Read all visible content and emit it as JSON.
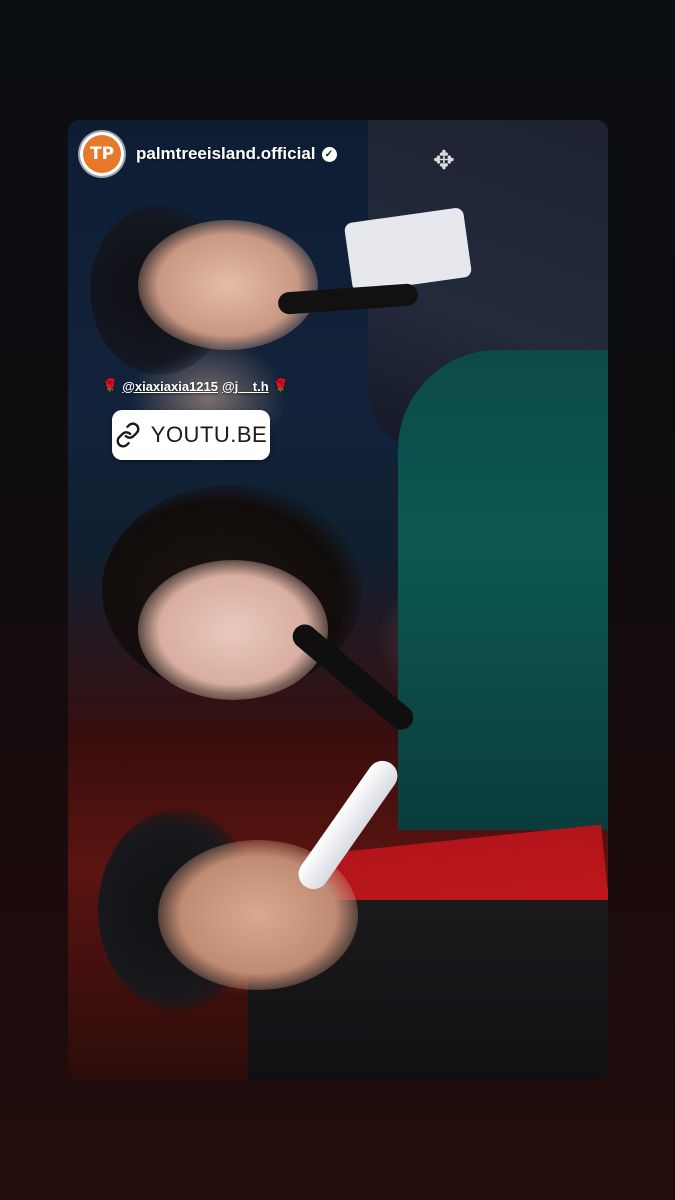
{
  "story": {
    "account": {
      "username": "palmtreeisland.official",
      "avatar_text": "TP",
      "avatar_color": "#e8792b",
      "verified_icon": "verified-badge-icon"
    },
    "mentions": {
      "leading_emoji": "🌹",
      "users": [
        "@xiaxiaxia1215",
        "@j__t.h"
      ],
      "trailing_emoji": "🌹"
    },
    "link_sticker": {
      "label": "YOUTU.BE",
      "icon": "link-icon"
    }
  }
}
